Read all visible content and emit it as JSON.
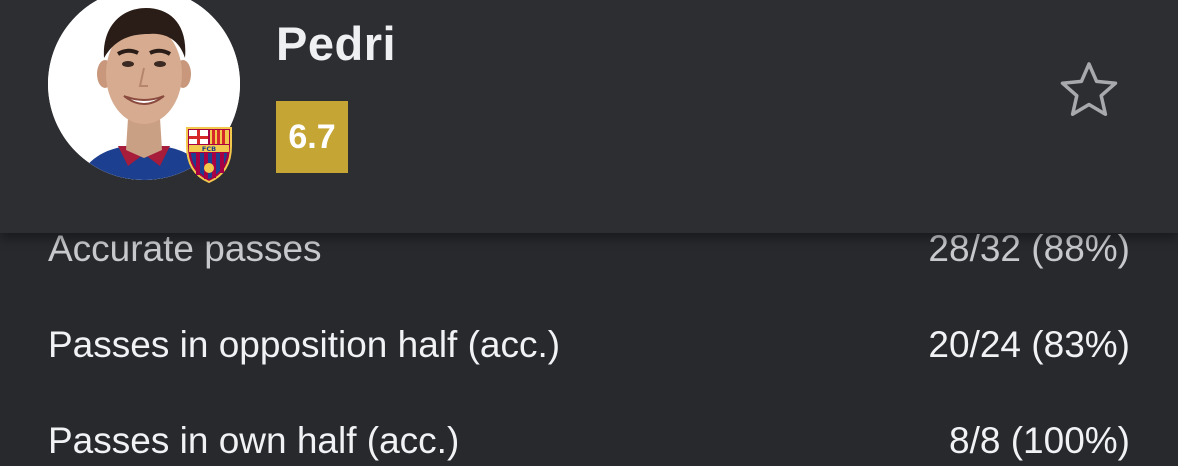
{
  "player": {
    "name": "Pedri",
    "rating": "6.7",
    "club_badge_letters": "FCB"
  },
  "stats": [
    {
      "label": "Accurate passes",
      "value": "28/32 (88%)"
    },
    {
      "label": "Passes in opposition half (acc.)",
      "value": "20/24 (83%)"
    },
    {
      "label": "Passes in own half (acc.)",
      "value": "8/8 (100%)"
    }
  ],
  "icons": {
    "favorite": "star-outline-icon",
    "club": "fc-barcelona-crest-icon"
  },
  "colors": {
    "rating_badge": "#c5a634",
    "header_bg": "#2c2e32",
    "page_bg": "#27292d"
  }
}
